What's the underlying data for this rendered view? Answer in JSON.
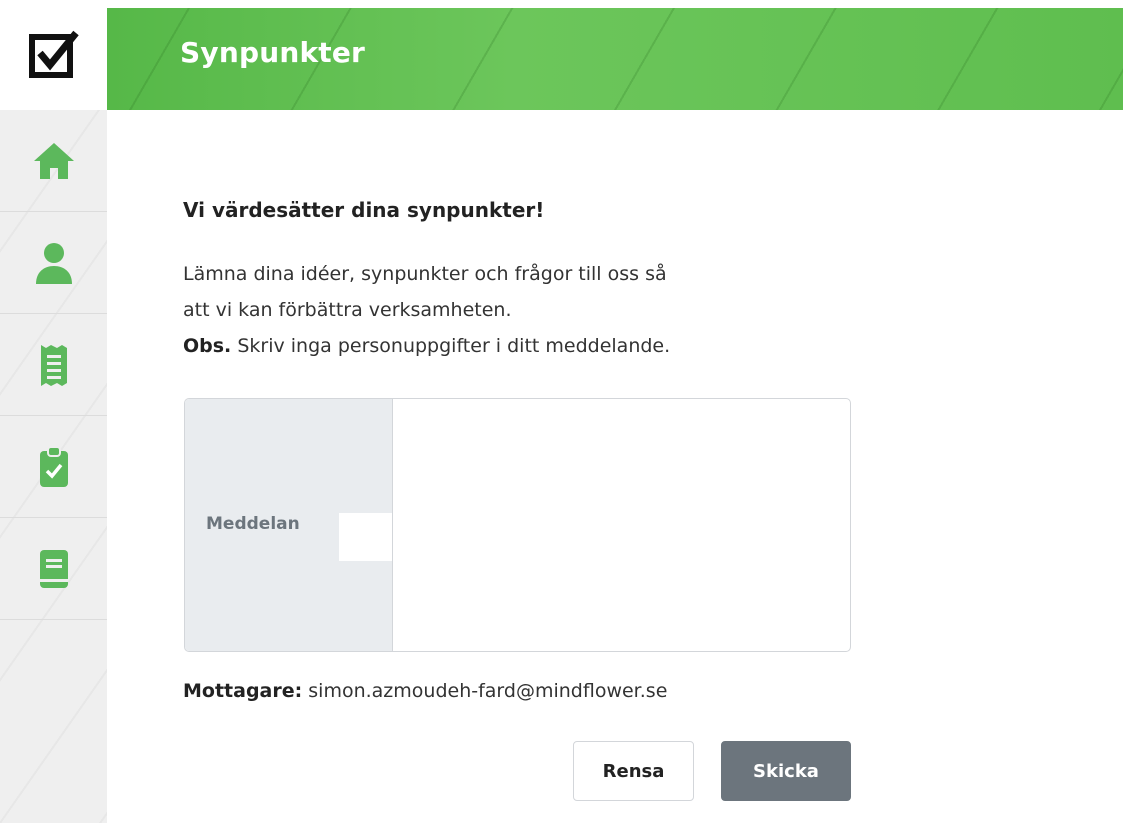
{
  "app": {
    "logo": "checkbox-logo-icon"
  },
  "header": {
    "title": "Synpunkter"
  },
  "sidebar": {
    "items": [
      {
        "icon": "home-icon",
        "color": "#5cb85c"
      },
      {
        "icon": "user-icon",
        "color": "#5cb85c"
      },
      {
        "icon": "receipt-icon",
        "color": "#5cb85c"
      },
      {
        "icon": "clipboard-check-icon",
        "color": "#5cb85c"
      },
      {
        "icon": "book-icon",
        "color": "#5cb85c"
      }
    ]
  },
  "main": {
    "title": "Vi värdesätter dina synpunkter!",
    "line1": "Lämna dina idéer, synpunkter och frågor till oss så",
    "line2": "att vi kan förbättra verksamheten.",
    "obs_label": "Obs.",
    "obs_text": " Skriv inga personuppgifter i ditt meddelande.",
    "message_label": "Meddelan",
    "message_value": "",
    "recipient_label": "Mottagare:",
    "recipient_value": " simon.azmoudeh-fard@mindflower.se",
    "clear_label": "Rensa",
    "send_label": "Skicka"
  },
  "colors": {
    "accent": "#5cb85c",
    "header": "#62be52",
    "send_button": "#6c757d"
  }
}
